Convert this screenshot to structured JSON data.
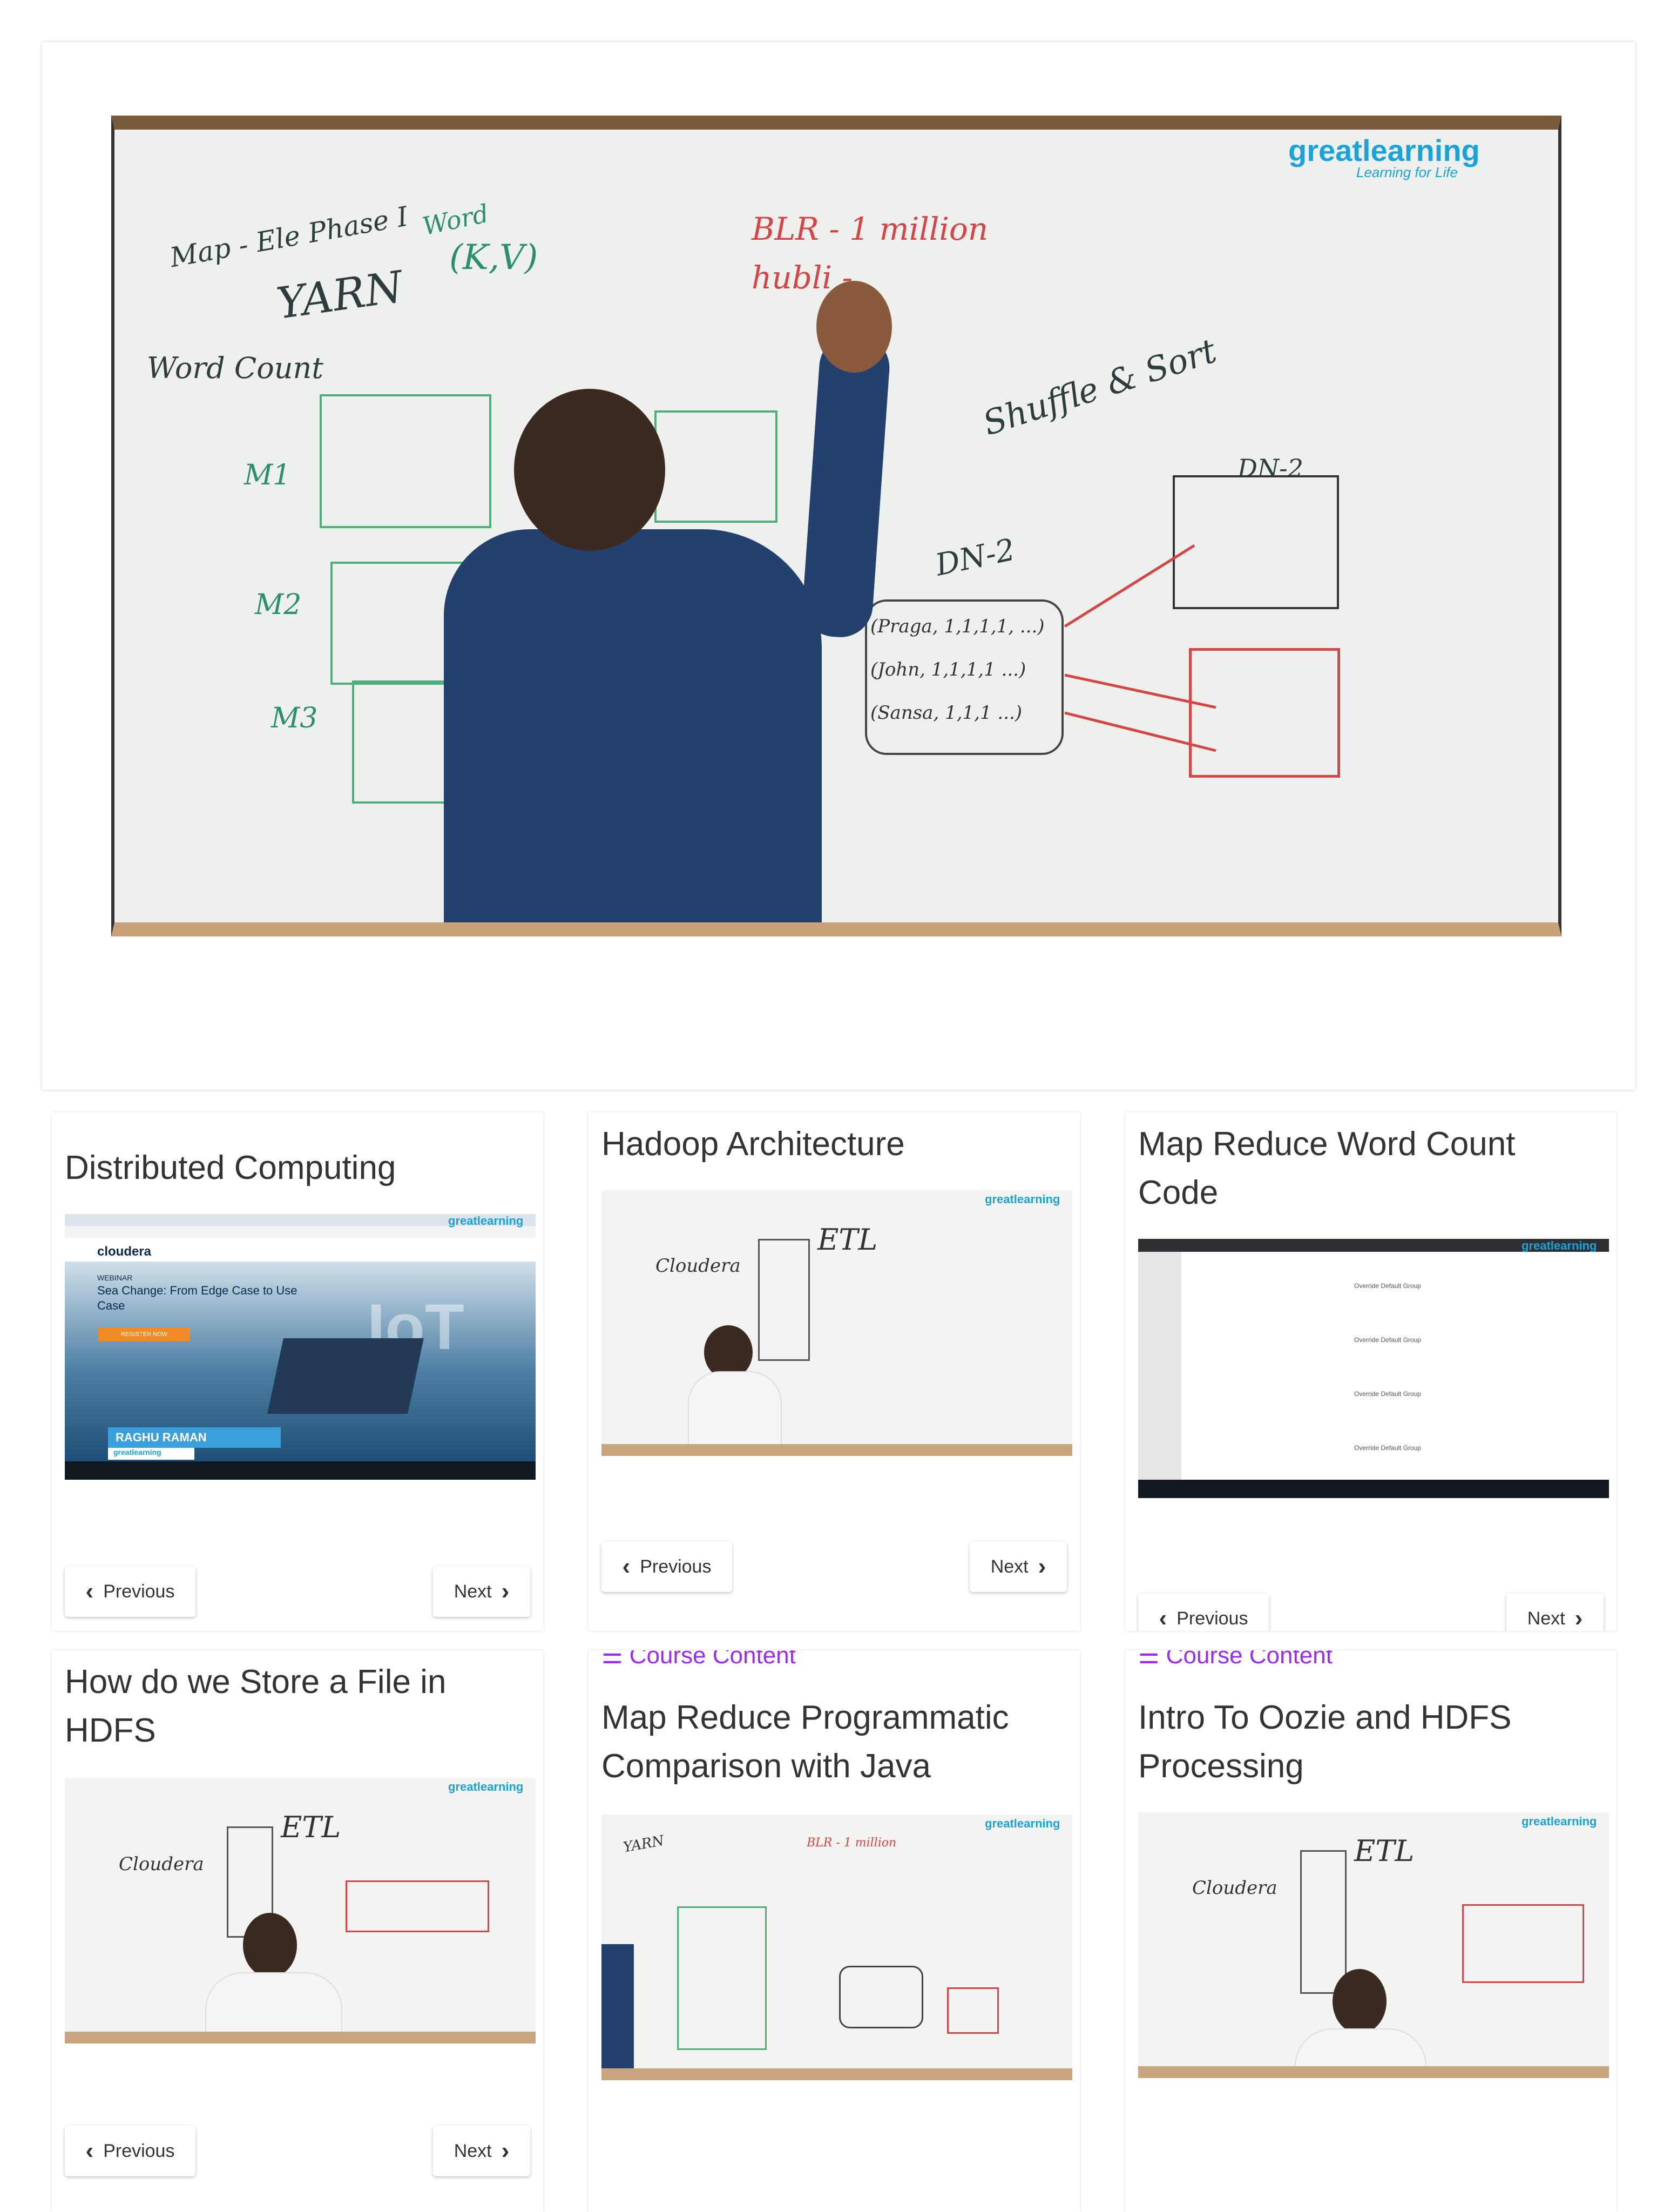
{
  "hero": {
    "logo_main": "greatlearning",
    "logo_tag": "Learning for Life",
    "board": {
      "top_left_1": "Map - Ele Phase I",
      "top_left_2": "YARN",
      "top_left_3": "(K,V)",
      "top_left_word": "Word",
      "word_count": "Word Count",
      "m1": "M1",
      "m2": "M2",
      "m3": "M3",
      "blr": "BLR - 1 million",
      "hubli": "hubli -",
      "shuffle": "Shuffle & Sort",
      "dn1": "DN-2",
      "dn2": "DN-2",
      "kv1": "(Praga, 1,1,1,1, ...)",
      "kv2": "(John, 1,1,1,1 ...)",
      "kv3": "(Sansa, 1,1,1 ...)"
    }
  },
  "cards": [
    {
      "title": "Distributed Computing",
      "prev": "Previous",
      "next": "Next"
    },
    {
      "title": "Hadoop Architecture",
      "prev": "Previous",
      "next": "Next"
    },
    {
      "title": "Map Reduce Word Count Code",
      "prev": "Previous",
      "next": "Next"
    },
    {
      "title": "How do we Store a File in HDFS",
      "prev": "Previous",
      "next": "Next"
    },
    {
      "title": "Map Reduce Programmatic Comparison with Java",
      "course_link": "Course Content"
    },
    {
      "title": "Intro To Oozie and HDFS Processing",
      "course_link": "Course Content"
    }
  ],
  "thumb_texts": {
    "cloudera": "cloudera",
    "webinar": "WEBINAR",
    "sea_change": "Sea Change: From Edge Case to Use Case",
    "register": "REGISTER NOW",
    "presenter": "RAGHU RAMAN",
    "presenter_org": "greatlearning",
    "iot": "IoT",
    "etl": "ETL",
    "cloudera_board": "Cloudera",
    "settings_label": "Override Default Group"
  },
  "colors": {
    "accent_purple": "#9b2cf0",
    "logo_blue": "#1aa3d9",
    "shirt_blue": "#23406f"
  }
}
